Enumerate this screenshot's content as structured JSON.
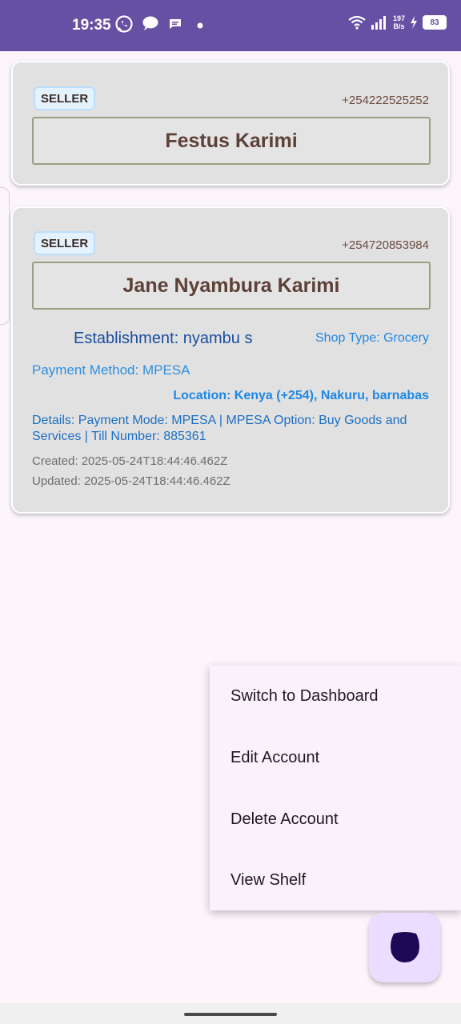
{
  "status_bar": {
    "time": "19:35",
    "net_speed_value": "197",
    "net_speed_unit": "B/s",
    "battery": "83",
    "icons": [
      "whatsapp-icon",
      "chat-bubble-icon",
      "message-icon",
      "dot-icon",
      "wifi-icon",
      "signal-icon",
      "charging-icon",
      "battery-icon"
    ],
    "color": "#6650a4"
  },
  "cards": [
    {
      "badge": "SELLER",
      "phone": "+254222525252",
      "name": "Festus Karimi"
    },
    {
      "badge": "SELLER",
      "phone": "+254720853984",
      "name": "Jane Nyambura Karimi",
      "establishment": "Establishment: nyambu s",
      "shop_type": "Shop Type: Grocery",
      "payment_method": "Payment Method: MPESA",
      "location": "Location: Kenya (+254), Nakuru, barnabas",
      "details": "Details: Payment Mode: MPESA | MPESA Option: Buy Goods and Services | Till Number: 885361",
      "created": "Created: 2025-05-24T18:44:46.462Z",
      "updated": "Updated: 2025-05-24T18:44:46.462Z"
    }
  ],
  "menu": {
    "items": [
      "Switch to Dashboard",
      "Edit Account",
      "Delete Account",
      "View Shelf"
    ]
  },
  "fab": {
    "icon": "blob-icon",
    "color": "#eaddff"
  }
}
